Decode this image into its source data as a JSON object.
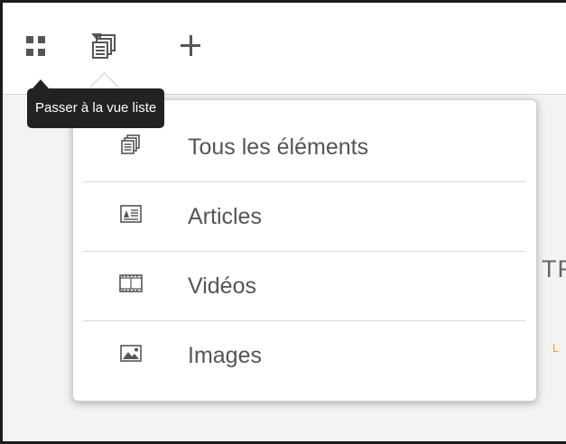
{
  "toolbar": {
    "icons": {
      "grid": "grid-icon",
      "stack": "stacked-pages-icon",
      "caret": "caret-down-icon",
      "add": "plus-icon"
    }
  },
  "tooltip": {
    "text": "Passer à la vue liste"
  },
  "menu": {
    "items": [
      {
        "label": "Tous les éléments",
        "icon": "stacked-pages-icon"
      },
      {
        "label": "Articles",
        "icon": "article-icon"
      },
      {
        "label": "Vidéos",
        "icon": "video-film-icon"
      },
      {
        "label": "Images",
        "icon": "image-icon"
      }
    ]
  },
  "background": {
    "partial_heading": "TR",
    "partial_link": "L"
  },
  "colors": {
    "icon": "#555555",
    "tooltip_bg": "#222222",
    "menu_text": "#555555",
    "link_accent": "#e0b300"
  }
}
